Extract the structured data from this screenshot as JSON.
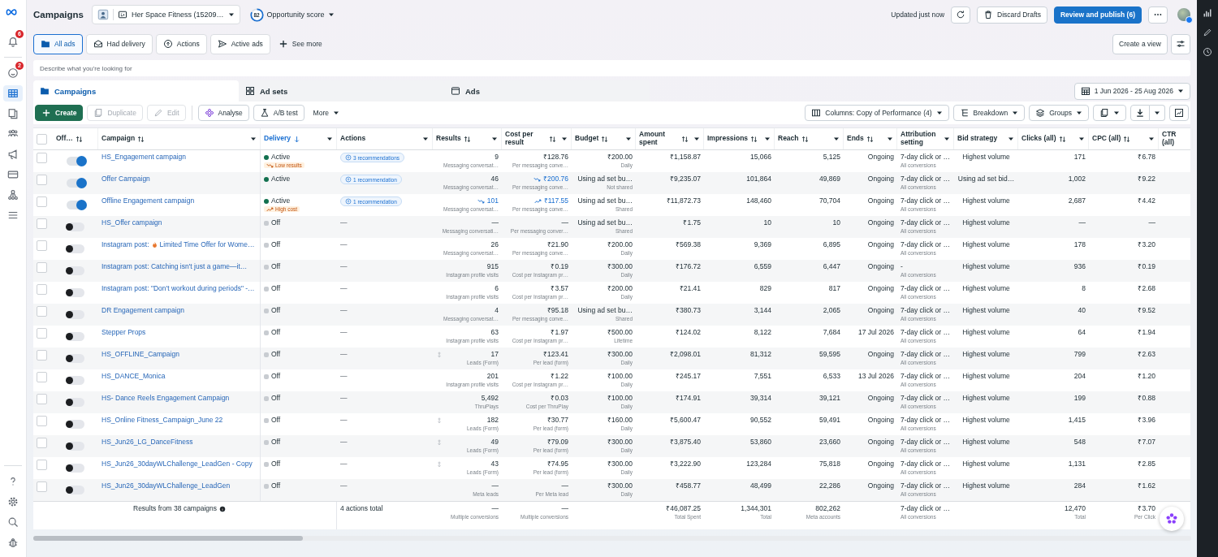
{
  "sidebar": {
    "top": [
      {
        "badge": "6",
        "selected": false
      },
      {
        "badge": "2",
        "selected": false
      },
      {
        "selected": true
      },
      {
        "selected": false
      },
      {
        "selected": false
      },
      {
        "selected": false
      },
      {
        "selected": false
      },
      {
        "selected": false
      },
      {
        "selected": false
      }
    ],
    "bottom": [
      {
        "selected": false
      },
      {
        "selected": false
      },
      {
        "selected": false
      },
      {
        "selected": false
      }
    ]
  },
  "header": {
    "title": "Campaigns",
    "account": "Her Space Fitness (15209…",
    "score": "82",
    "score_label": "Opportunity score",
    "updated": "Updated just now",
    "discard": "Discard Drafts",
    "publish": "Review and publish (6)"
  },
  "filters": [
    {
      "label": "All ads",
      "selected": true
    },
    {
      "label": "Had delivery",
      "selected": false
    },
    {
      "label": "Actions",
      "selected": false
    },
    {
      "label": "Active ads",
      "selected": false
    }
  ],
  "see_more": "See more",
  "create_view": "Create a view",
  "search": {
    "placeholder": "Describe what you're looking for"
  },
  "tabs": [
    {
      "label": "Campaigns",
      "selected": true
    },
    {
      "label": "Ad sets",
      "selected": false
    },
    {
      "label": "Ads",
      "selected": false
    }
  ],
  "date_range": "1 Jun 2026 - 25 Aug 2026",
  "actions": [
    {
      "label": "Create",
      "kind": "primary",
      "disabled": false
    },
    {
      "label": "Duplicate",
      "kind": "default",
      "disabled": true
    },
    {
      "label": "Edit",
      "kind": "default",
      "disabled": true
    },
    {
      "label": "Analyse",
      "kind": "default",
      "disabled": false
    },
    {
      "label": "A/B test",
      "kind": "default",
      "disabled": false
    },
    {
      "label": "More",
      "kind": "menu",
      "disabled": false
    }
  ],
  "view_buttons": [
    "Columns: Copy of Performance (4)",
    "Breakdown",
    "Groups"
  ],
  "all_checked": false,
  "columns": [
    {
      "label": "Off…",
      "sortable": true,
      "sorted": false,
      "menu": false
    },
    {
      "label": "Campaign",
      "sortable": true,
      "sorted": false,
      "menu": true
    },
    {
      "label": "Delivery",
      "sortable": false,
      "sorted": true,
      "menu": true
    },
    {
      "label": "Actions",
      "sortable": false,
      "sorted": false,
      "menu": true
    },
    {
      "label": "Results",
      "sortable": true,
      "sorted": false,
      "menu": true
    },
    {
      "label": "Cost per result",
      "sortable": true,
      "sorted": false,
      "menu": true
    },
    {
      "label": "Budget",
      "sortable": true,
      "sorted": false,
      "menu": true
    },
    {
      "label": "Amount spent",
      "sortable": true,
      "sorted": false,
      "menu": true
    },
    {
      "label": "Impressions",
      "sortable": true,
      "sorted": false,
      "menu": true
    },
    {
      "label": "Reach",
      "sortable": true,
      "sorted": false,
      "menu": true
    },
    {
      "label": "Ends",
      "sortable": true,
      "sorted": false,
      "menu": true
    },
    {
      "label": "Attribution setting",
      "sortable": false,
      "sorted": false,
      "menu": true
    },
    {
      "label": "Bid strategy",
      "sortable": false,
      "sorted": false,
      "menu": true
    },
    {
      "label": "Clicks (all)",
      "sortable": true,
      "sorted": false,
      "menu": true
    },
    {
      "label": "CPC (all)",
      "sortable": true,
      "sorted": false,
      "menu": true
    },
    {
      "label": "CTR (all)",
      "sortable": false,
      "sorted": false,
      "menu": false
    }
  ],
  "rows": [
    {
      "checked": false,
      "on": true,
      "name": "HS_Engagement campaign",
      "status": "Active",
      "active": true,
      "flag": {
        "kind": "low",
        "label": "Low results"
      },
      "actions": "3 recommendations",
      "recommendation": true,
      "result": "9",
      "result_sub": "Messaging conversat…",
      "cost": "₹128.76",
      "cost_sub": "Per messaging conve…",
      "budget": "₹200.00",
      "budget_sub": "Daily",
      "spent": "₹1,158.87",
      "impressions": "15,066",
      "reach": "5,125",
      "ends": "Ongoing",
      "attribution": "7-day click or …",
      "attribution_sub": "All conversions",
      "bid": "Highest volume",
      "clicks": "171",
      "cpc": "₹6.78"
    },
    {
      "checked": false,
      "on": true,
      "name": "Offer Campaign",
      "status": "Active",
      "active": true,
      "actions": "1 recommendation",
      "recommendation": true,
      "result": "46",
      "result_sub": "Messaging conversat…",
      "cost": "₹200.76",
      "cost_trend": {
        "kind": "down"
      },
      "cost_sub": "Per messaging conve…",
      "budget": "Using ad set bu…",
      "budget_sub": "Not shared",
      "spent": "₹9,235.07",
      "impressions": "101,864",
      "reach": "49,869",
      "ends": "Ongoing",
      "attribution": "7-day click or …",
      "attribution_sub": "All conversions",
      "bid": "Using ad set bid…",
      "clicks": "1,002",
      "cpc": "₹9.22"
    },
    {
      "checked": false,
      "on": true,
      "name": "Offline Engagement campaign",
      "status": "Active",
      "active": true,
      "flag": {
        "kind": "high",
        "label": "High cost"
      },
      "actions": "1 recommendation",
      "recommendation": true,
      "result": "101",
      "result_trend": {
        "kind": "down"
      },
      "result_sub": "Messaging conversat…",
      "cost": "₹117.55",
      "cost_trend": {
        "kind": "up"
      },
      "cost_sub": "Per messaging conve…",
      "budget": "Using ad set bu…",
      "budget_sub": "Shared",
      "spent": "₹11,872.73",
      "impressions": "148,460",
      "reach": "70,704",
      "ends": "Ongoing",
      "attribution": "7-day click or …",
      "attribution_sub": "All conversions",
      "bid": "Highest volume",
      "clicks": "2,687",
      "cpc": "₹4.42"
    },
    {
      "checked": false,
      "on": false,
      "name": "HS_Offer campaign",
      "status": "Off",
      "active": false,
      "actions": "—",
      "recommendation": false,
      "result": "—",
      "result_sub": "Messaging conversati…",
      "cost": "—",
      "cost_sub": "Per messaging conver…",
      "budget": "Using ad set bu…",
      "budget_sub": "Shared",
      "spent": "₹1.75",
      "impressions": "10",
      "reach": "10",
      "ends": "Ongoing",
      "attribution": "7-day click or …",
      "attribution_sub": "All conversions",
      "bid": "Highest volume",
      "clicks": "—",
      "cpc": "—"
    },
    {
      "checked": false,
      "on": false,
      "name": "Instagram post:",
      "flame": true,
      "name_rest": "Limited Time Offer for Wome…",
      "status": "Off",
      "active": false,
      "actions": "—",
      "recommendation": false,
      "result": "26",
      "result_sub": "Messaging conversat…",
      "cost": "₹21.90",
      "cost_sub": "Per messaging conve…",
      "budget": "₹200.00",
      "budget_sub": "Daily",
      "spent": "₹569.38",
      "impressions": "9,369",
      "reach": "6,895",
      "ends": "Ongoing",
      "attribution": "7-day click or …",
      "attribution_sub": "All conversions",
      "bid": "Highest volume",
      "clicks": "178",
      "cpc": "₹3.20"
    },
    {
      "checked": false,
      "on": false,
      "name": "Instagram post: Catching isn't just a game—it…",
      "status": "Off",
      "active": false,
      "actions": "—",
      "recommendation": false,
      "result": "915",
      "result_sub": "Instagram profile visits",
      "cost": "₹0.19",
      "cost_sub": "Cost per Instagram pr…",
      "budget": "₹300.00",
      "budget_sub": "Daily",
      "spent": "₹176.72",
      "impressions": "6,559",
      "reach": "6,447",
      "ends": "Ongoing",
      "attribution": "-",
      "attribution_sub": "All conversions",
      "bid": "Highest volume",
      "clicks": "936",
      "cpc": "₹0.19"
    },
    {
      "checked": false,
      "on": false,
      "name": "Instagram post: \"Don't workout during periods\" -…",
      "status": "Off",
      "active": false,
      "actions": "—",
      "recommendation": false,
      "result": "6",
      "result_sub": "Instagram profile visits",
      "cost": "₹3.57",
      "cost_sub": "Cost per Instagram pr…",
      "budget": "₹200.00",
      "budget_sub": "Daily",
      "spent": "₹21.41",
      "impressions": "829",
      "reach": "817",
      "ends": "Ongoing",
      "attribution": "7-day click or …",
      "attribution_sub": "All conversions",
      "bid": "Highest volume",
      "clicks": "8",
      "cpc": "₹2.68"
    },
    {
      "checked": false,
      "on": false,
      "name": "DR Engagement campaign",
      "status": "Off",
      "active": false,
      "actions": "—",
      "recommendation": false,
      "result": "4",
      "result_sub": "Messaging conversat…",
      "cost": "₹95.18",
      "cost_sub": "Per messaging conve…",
      "budget": "Using ad set bu…",
      "budget_sub": "Shared",
      "spent": "₹380.73",
      "impressions": "3,144",
      "reach": "2,065",
      "ends": "Ongoing",
      "attribution": "7-day click or …",
      "attribution_sub": "All conversions",
      "bid": "Highest volume",
      "clicks": "40",
      "cpc": "₹9.52"
    },
    {
      "checked": false,
      "on": false,
      "name": "Stepper Props",
      "status": "Off",
      "active": false,
      "actions": "—",
      "recommendation": false,
      "result": "63",
      "result_sub": "Instagram profile visits",
      "cost": "₹1.97",
      "cost_sub": "Cost per Instagram pr…",
      "budget": "₹500.00",
      "budget_sub": "Lifetime",
      "spent": "₹124.02",
      "impressions": "8,122",
      "reach": "7,684",
      "ends": "17 Jul 2026",
      "attribution": "7-day click or …",
      "attribution_sub": "All conversions",
      "bid": "Highest volume",
      "clicks": "64",
      "cpc": "₹1.94"
    },
    {
      "checked": false,
      "on": false,
      "name": "HS_OFFLINE_Campaign",
      "status": "Off",
      "active": false,
      "actions": "—",
      "recommendation": false,
      "lead": true,
      "result": "17",
      "result_sub": "Leads (Form)",
      "cost": "₹123.41",
      "cost_sub": "Per lead (form)",
      "budget": "₹300.00",
      "budget_sub": "Daily",
      "spent": "₹2,098.01",
      "impressions": "81,312",
      "reach": "59,595",
      "ends": "Ongoing",
      "attribution": "7-day click or …",
      "attribution_sub": "All conversions",
      "bid": "Highest volume",
      "clicks": "799",
      "cpc": "₹2.63"
    },
    {
      "checked": false,
      "on": false,
      "name": "HS_DANCE_Monica",
      "status": "Off",
      "active": false,
      "actions": "—",
      "recommendation": false,
      "result": "201",
      "result_sub": "Instagram profile visits",
      "cost": "₹1.22",
      "cost_sub": "Cost per Instagram pr…",
      "budget": "₹100.00",
      "budget_sub": "Daily",
      "spent": "₹245.17",
      "impressions": "7,551",
      "reach": "6,533",
      "ends": "13 Jul 2026",
      "attribution": "7-day click or …",
      "attribution_sub": "All conversions",
      "bid": "Highest volume",
      "clicks": "204",
      "cpc": "₹1.20"
    },
    {
      "checked": false,
      "on": false,
      "name": "HS- Dance Reels Engagement Campaign",
      "status": "Off",
      "active": false,
      "actions": "—",
      "recommendation": false,
      "result": "5,492",
      "result_sub": "ThruPlays",
      "cost": "₹0.03",
      "cost_sub": "Cost per ThruPlay",
      "budget": "₹100.00",
      "budget_sub": "Daily",
      "spent": "₹174.91",
      "impressions": "39,314",
      "reach": "39,121",
      "ends": "Ongoing",
      "attribution": "7-day click or …",
      "attribution_sub": "All conversions",
      "bid": "Highest volume",
      "clicks": "199",
      "cpc": "₹0.88"
    },
    {
      "checked": false,
      "on": false,
      "name": "HS_Online Fitness_Campaign_June 22",
      "status": "Off",
      "active": false,
      "actions": "—",
      "recommendation": false,
      "lead": true,
      "result": "182",
      "result_sub": "Leads (Form)",
      "cost": "₹30.77",
      "cost_sub": "Per lead (form)",
      "budget": "₹160.00",
      "budget_sub": "Daily",
      "spent": "₹5,600.47",
      "impressions": "90,552",
      "reach": "59,491",
      "ends": "Ongoing",
      "attribution": "7-day click or …",
      "attribution_sub": "All conversions",
      "bid": "Highest volume",
      "clicks": "1,415",
      "cpc": "₹3.96"
    },
    {
      "checked": false,
      "on": false,
      "name": "HS_Jun26_LG_DanceFitness",
      "status": "Off",
      "active": false,
      "actions": "—",
      "recommendation": false,
      "lead": true,
      "result": "49",
      "result_sub": "Leads (Form)",
      "cost": "₹79.09",
      "cost_sub": "Per lead (form)",
      "budget": "₹300.00",
      "budget_sub": "Daily",
      "spent": "₹3,875.40",
      "impressions": "53,860",
      "reach": "23,660",
      "ends": "Ongoing",
      "attribution": "7-day click or …",
      "attribution_sub": "All conversions",
      "bid": "Highest volume",
      "clicks": "548",
      "cpc": "₹7.07"
    },
    {
      "checked": false,
      "on": false,
      "name": "HS_Jun26_30dayWLChallenge_LeadGen - Copy",
      "status": "Off",
      "active": false,
      "actions": "—",
      "recommendation": false,
      "lead": true,
      "result": "43",
      "result_sub": "Leads (Form)",
      "cost": "₹74.95",
      "cost_sub": "Per lead (form)",
      "budget": "₹300.00",
      "budget_sub": "Daily",
      "spent": "₹3,222.90",
      "impressions": "123,284",
      "reach": "75,818",
      "ends": "Ongoing",
      "attribution": "7-day click or …",
      "attribution_sub": "All conversions",
      "bid": "Highest volume",
      "clicks": "1,131",
      "cpc": "₹2.85"
    },
    {
      "checked": false,
      "on": false,
      "name": "HS_Jun26_30dayWLChallenge_LeadGen",
      "status": "Off",
      "active": false,
      "actions": "—",
      "recommendation": false,
      "result": "—",
      "result_sub": "Meta leads",
      "cost": "—",
      "cost_sub": "Per Meta lead",
      "budget": "₹300.00",
      "budget_sub": "Daily",
      "spent": "₹458.77",
      "impressions": "48,499",
      "reach": "22,286",
      "ends": "Ongoing",
      "attribution": "7-day click or …",
      "attribution_sub": "All conversions",
      "bid": "Highest volume",
      "clicks": "284",
      "cpc": "₹1.62"
    }
  ],
  "footer": {
    "summary": "Results from 38 campaigns",
    "actions": "4 actions total",
    "result": "—",
    "result_sub": "Multiple conversions",
    "cost": "—",
    "cost_sub": "Multiple conversions",
    "spent": "₹46,087.25",
    "spent_sub": "Total Spent",
    "impressions": "1,344,301",
    "impressions_sub": "Total",
    "reach": "802,262",
    "reach_sub": "Meta accounts",
    "attribution": "7-day click or …",
    "attribution_sub": "All conversions",
    "clicks": "12,470",
    "clicks_sub": "Total",
    "cpc": "₹3.70",
    "cpc_sub": "Per Click"
  }
}
